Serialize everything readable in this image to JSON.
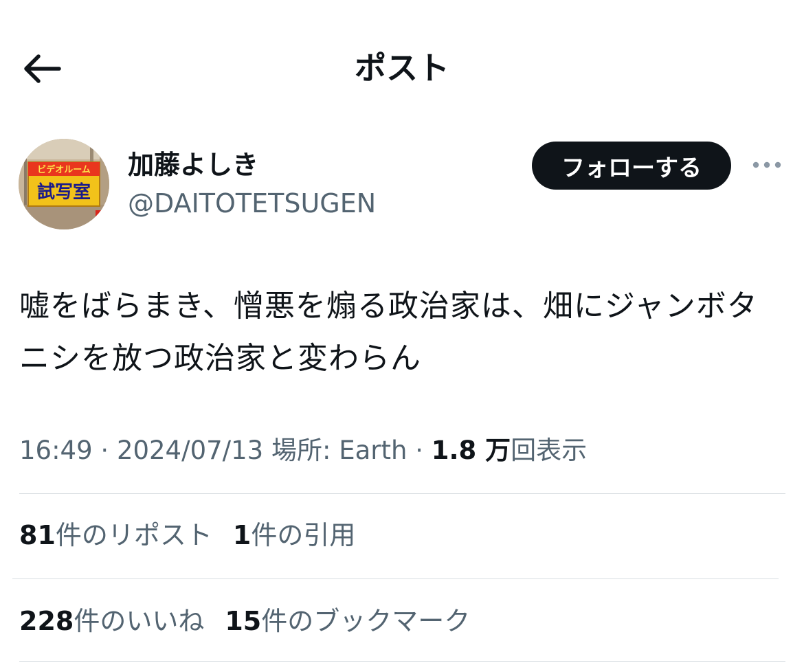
{
  "header": {
    "title": "ポスト",
    "back_icon": "arrow-left-icon"
  },
  "author": {
    "display_name": "加藤よしき",
    "handle": "@DAITOTETSUGEN",
    "avatar_sign_line1": "ビデオルーム",
    "avatar_sign_line2": "試写室"
  },
  "actions": {
    "follow_label": "フォローする",
    "more_icon": "more-horizontal-icon"
  },
  "post": {
    "text": "嘘をばらまき、憎悪を煽る政治家は、畑にジャンボタニシを放つ政治家と変わらん"
  },
  "meta": {
    "time": "16:49",
    "separator": "·",
    "date": "2024/07/13",
    "location": "場所: Earth",
    "views_count": "1.8 万",
    "views_label": "回表示"
  },
  "stats": {
    "reposts_count": "81",
    "reposts_label": "件のリポスト",
    "quotes_count": "1",
    "quotes_label": "件の引用",
    "likes_count": "228",
    "likes_label": "件のいいね",
    "bookmarks_count": "15",
    "bookmarks_label": "件のブックマーク"
  },
  "colors": {
    "text_primary": "#0f1419",
    "text_secondary": "#536471",
    "follow_bg": "#0f1419",
    "divider": "#d8dde1",
    "sign_yellow": "#f2c21a",
    "sign_red": "#d9261c"
  }
}
